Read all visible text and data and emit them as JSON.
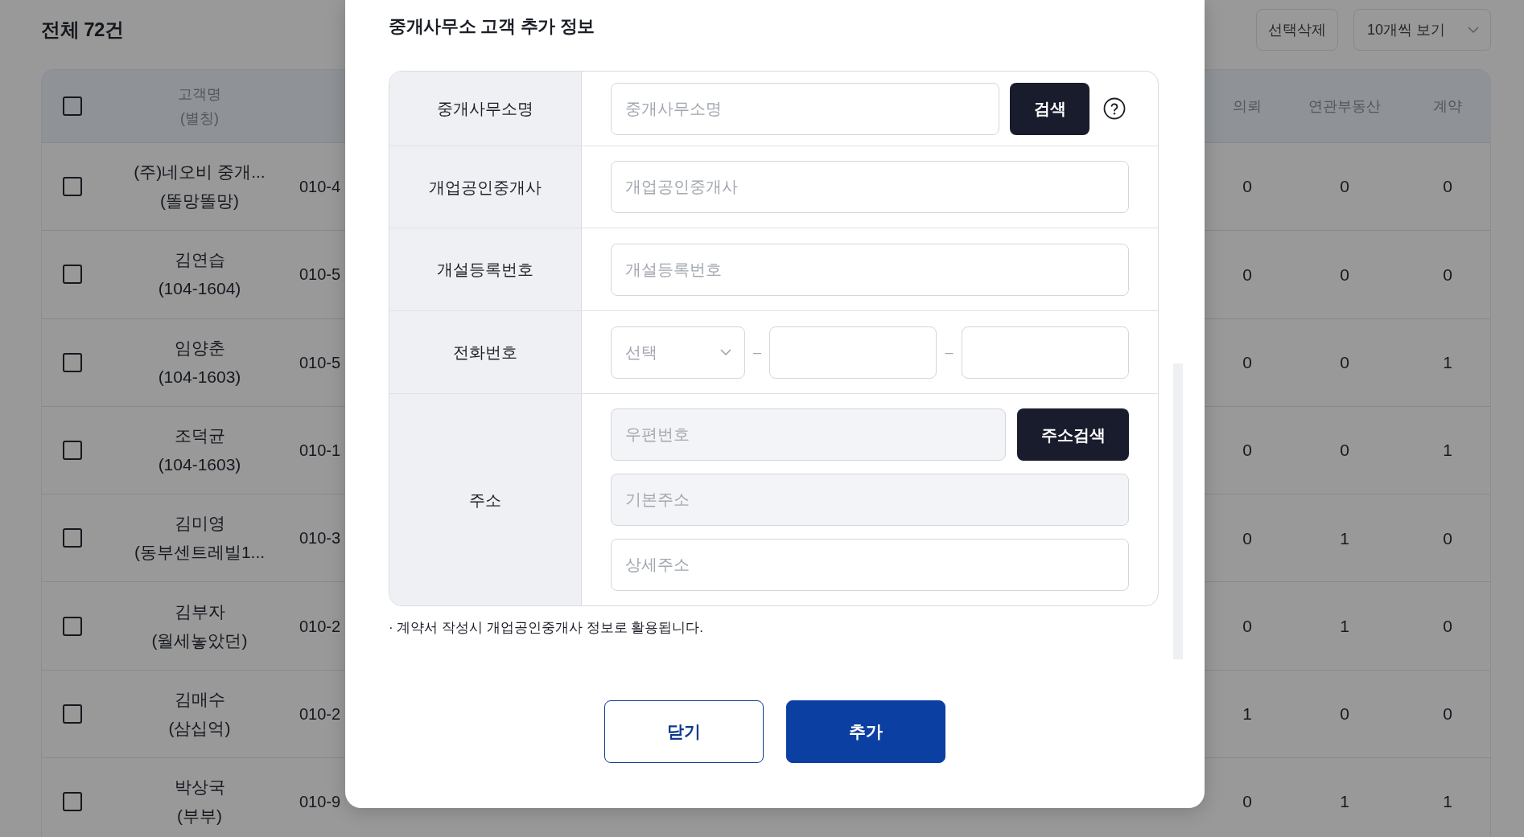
{
  "page": {
    "title": "전체 72건",
    "delete_button": "선택삭제",
    "page_size": "10개씩 보기"
  },
  "table": {
    "header_checkbox": {
      "checked": false
    },
    "columns": [
      {
        "label": "고객명",
        "sublabel": "(별칭)"
      },
      {
        "label": "의뢰"
      },
      {
        "label": "연관부동산"
      },
      {
        "label": "계약"
      }
    ],
    "rows": [
      {
        "checked": false,
        "name": "(주)네오비 중개...",
        "alias": "(똘망똘망)",
        "column_3": "010-4",
        "requests": "0",
        "related_properties": "0",
        "contracts": "0"
      },
      {
        "checked": false,
        "name": "김연습",
        "alias": "(104-1604)",
        "column_3": "010-5",
        "requests": "0",
        "related_properties": "0",
        "contracts": "0"
      },
      {
        "checked": false,
        "name": "임양춘",
        "alias": "(104-1603)",
        "column_3": "010-5",
        "requests": "0",
        "related_properties": "0",
        "contracts": "1"
      },
      {
        "checked": false,
        "name": "조덕균",
        "alias": "(104-1603)",
        "column_3": "010-1",
        "requests": "0",
        "related_properties": "0",
        "contracts": "1"
      },
      {
        "checked": false,
        "name": "김미영",
        "alias": "(동부센트레빌1...",
        "column_3": "010-3",
        "requests": "0",
        "related_properties": "1",
        "contracts": "0"
      },
      {
        "checked": false,
        "name": "김부자",
        "alias": "(월세놓았던)",
        "column_3": "010-2",
        "requests": "0",
        "related_properties": "1",
        "contracts": "0"
      },
      {
        "checked": false,
        "name": "김매수",
        "alias": "(삼십억)",
        "column_3": "010-2",
        "requests": "1",
        "related_properties": "0",
        "contracts": "0"
      },
      {
        "checked": false,
        "name": "박상국",
        "alias": "(부부)",
        "column_3": "010-9",
        "requests": "0",
        "related_properties": "1",
        "contracts": "1"
      }
    ]
  },
  "dialog": {
    "title": "중개사무소 고객 추가 정보",
    "fields": [
      {
        "kind": "search",
        "label": "중개사무소명",
        "placeholder": "중개사무소명",
        "button": "검색"
      },
      {
        "kind": "text",
        "label": "개업공인중개사",
        "placeholder": "개업공인중개사"
      },
      {
        "kind": "text",
        "label": "개설등록번호",
        "placeholder": "개설등록번호"
      },
      {
        "kind": "phone",
        "label": "전화번호",
        "select_placeholder": "선택",
        "separators": [
          "–",
          "–"
        ]
      },
      {
        "kind": "address",
        "label": "주소",
        "button": "주소검색",
        "inputs": [
          {
            "placeholder": "우편번호",
            "disabled": true
          },
          {
            "placeholder": "기본주소",
            "disabled": true
          },
          {
            "placeholder": "상세주소",
            "disabled": false
          }
        ]
      }
    ],
    "note": "· 계약서 작성시 개업공인중개사 정보로 활용됩니다.",
    "buttons": [
      {
        "kind": "secondary",
        "label": "닫기"
      },
      {
        "kind": "primary",
        "label": "추가"
      }
    ]
  }
}
